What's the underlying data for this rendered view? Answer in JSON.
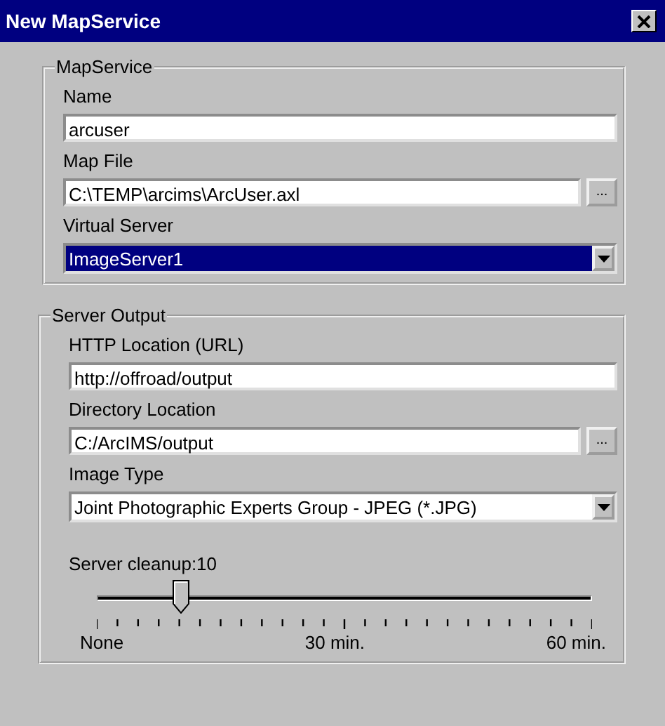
{
  "window": {
    "title": "New MapService"
  },
  "groups": [
    {
      "title": "MapService",
      "fields": [
        {
          "kind": "text",
          "label": "Name",
          "value": "arcuser"
        },
        {
          "kind": "file",
          "label": "Map File",
          "value": "C:\\TEMP\\arcims\\ArcUser.axl",
          "button": "..."
        },
        {
          "kind": "select",
          "label": "Virtual Server",
          "value": "ImageServer1",
          "focused": true
        }
      ]
    },
    {
      "title": "Server Output",
      "fields": [
        {
          "kind": "text",
          "label": "HTTP Location (URL)",
          "value": "http://offroad/output"
        },
        {
          "kind": "file",
          "label": "Directory Location",
          "value": "C:/ArcIMS/output",
          "button": "..."
        },
        {
          "kind": "select",
          "label": "Image Type",
          "value": "Joint Photographic Experts Group - JPEG (*.JPG)",
          "focused": false
        },
        {
          "kind": "slider",
          "label": "Server cleanup:10",
          "level": 0.1667,
          "scale": [
            "None",
            "30 min.",
            "60 min."
          ]
        }
      ]
    }
  ]
}
